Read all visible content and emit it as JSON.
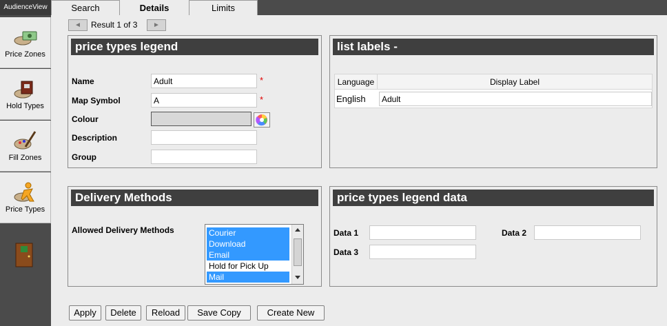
{
  "app": {
    "brand": "AudienceView"
  },
  "sidebar": {
    "items": [
      {
        "label": "Price Zones",
        "icon": "price-zones-icon"
      },
      {
        "label": "Hold Types",
        "icon": "hold-types-icon"
      },
      {
        "label": "Fill Zones",
        "icon": "fill-zones-icon"
      },
      {
        "label": "Price Types",
        "icon": "price-types-icon"
      }
    ],
    "exit_icon": "exit-door-icon"
  },
  "tabs": [
    {
      "label": "Search"
    },
    {
      "label": "Details"
    },
    {
      "label": "Limits"
    }
  ],
  "result_nav": {
    "text": "Result 1 of 3",
    "prev": "◄",
    "next": "►"
  },
  "legend": {
    "title": "price types legend",
    "name_label": "Name",
    "name_value": "Adult",
    "map_symbol_label": "Map Symbol",
    "map_symbol_value": "A",
    "colour_label": "Colour",
    "description_label": "Description",
    "group_label": "Group",
    "required_marker": "*"
  },
  "list_labels": {
    "title": "list labels -",
    "col_language": "Language",
    "col_display_label": "Display Label",
    "row_language": "English",
    "row_display_label": "Adult"
  },
  "delivery": {
    "title": "Delivery Methods",
    "label": "Allowed Delivery Methods",
    "options": [
      {
        "label": "Courier",
        "selected": true
      },
      {
        "label": "Download",
        "selected": true
      },
      {
        "label": "Email",
        "selected": true
      },
      {
        "label": "Hold for Pick Up",
        "selected": false
      },
      {
        "label": "Mail",
        "selected": true
      }
    ]
  },
  "legend_data": {
    "title": "price types legend data",
    "data1_label": "Data 1",
    "data2_label": "Data 2",
    "data3_label": "Data 3"
  },
  "buttons": {
    "apply": "Apply",
    "delete": "Delete",
    "reload": "Reload",
    "save_copy": "Save Copy",
    "create_new": "Create New"
  },
  "colors": {
    "accent_selected": "#3399ff",
    "header_bg": "#3f3f3f",
    "required": "#e00000"
  }
}
